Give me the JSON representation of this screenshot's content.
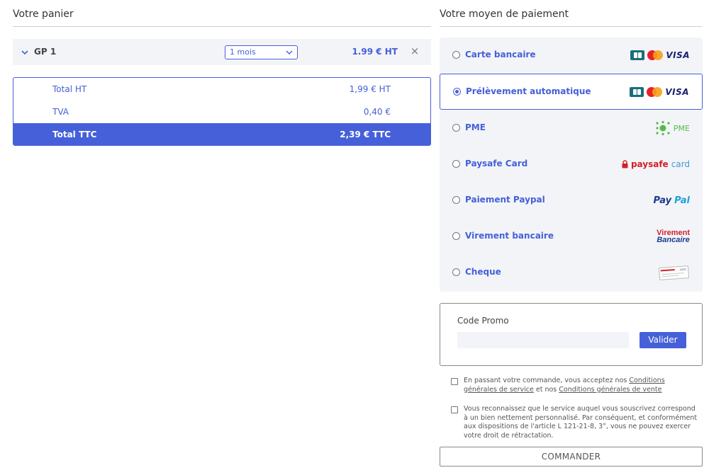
{
  "cart": {
    "title": "Votre panier",
    "item": {
      "name": "GP 1",
      "duration": "1 mois",
      "price": "1.99 € HT",
      "remove": "×"
    },
    "totals": {
      "ht_label": "Total HT",
      "ht_value": "1,99 € HT",
      "tva_label": "TVA",
      "tva_value": "0,40 €",
      "ttc_label": "Total TTC",
      "ttc_value": "2,39 € TTC"
    }
  },
  "payment": {
    "title": "Votre moyen de paiement",
    "selected": "Prélèvement automatique",
    "options": [
      {
        "label": "Carte bancaire",
        "logo": "cb-mastercard-visa"
      },
      {
        "label": "Prélèvement automatique",
        "logo": "cb-mastercard-visa"
      },
      {
        "label": "PME",
        "logo": "pme"
      },
      {
        "label": "Paysafe Card",
        "logo": "paysafecard"
      },
      {
        "label": "Paiement Paypal",
        "logo": "paypal"
      },
      {
        "label": "Virement bancaire",
        "logo": "virement-bancaire"
      },
      {
        "label": "Cheque",
        "logo": "cheque"
      }
    ],
    "logos": {
      "visa": "VISA",
      "pme": "PME",
      "paysafe_a": "paysafe",
      "paysafe_b": "card",
      "paypal_a": "Pay",
      "paypal_b": "Pal",
      "virement_a": "Virement",
      "virement_b": "Bancaire"
    }
  },
  "promo": {
    "title": "Code Promo",
    "placeholder": "",
    "button": "Valider"
  },
  "legal": {
    "cgv_prefix": "En passant votre commande, vous acceptez nos ",
    "cgv_link1": "Conditions générales de service",
    "cgv_mid": " et nos ",
    "cgv_link2": "Conditions générales de vente",
    "retract": "Vous reconnaissez que le service auquel vous souscrivez correspond à un bien nettement personnalisé. Par conséquent, et conformément aux dispositions de l'article L 121-21-8, 3°, vous ne pouvez exercer votre droit de rétractation."
  },
  "order_button": "COMMANDER",
  "colors": {
    "accent": "#4560d9",
    "panel_bg": "#f3f4f8"
  }
}
